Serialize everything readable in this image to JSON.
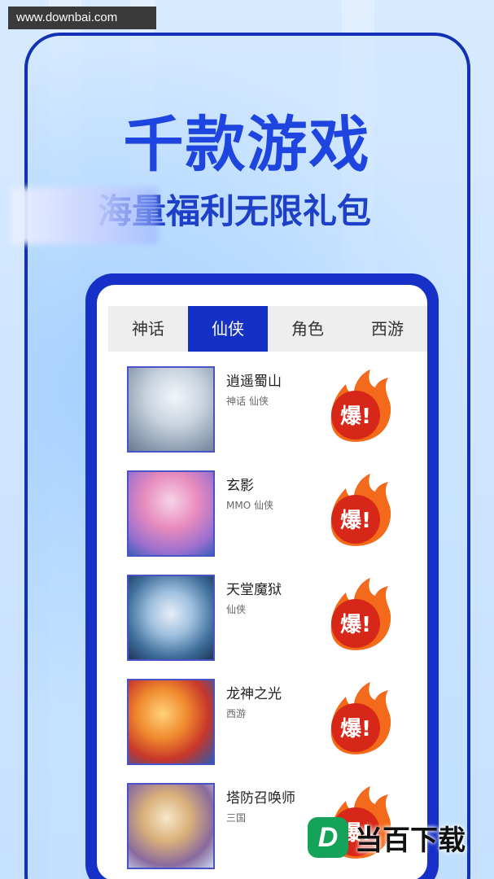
{
  "watermark": {
    "url": "www.downbai.com"
  },
  "hero": {
    "title": "千款游戏",
    "subtitle": "海量福利无限礼包"
  },
  "tabs": [
    {
      "label": "神话",
      "active": false
    },
    {
      "label": "仙侠",
      "active": true
    },
    {
      "label": "角色",
      "active": false
    },
    {
      "label": "西游",
      "active": false
    }
  ],
  "games": [
    {
      "name": "逍遥蜀山",
      "tags": "神话 仙侠",
      "badge": "爆!"
    },
    {
      "name": "玄影",
      "tags": "MMO 仙侠",
      "badge": "爆!"
    },
    {
      "name": "天堂魔狱",
      "tags": "仙侠",
      "badge": "爆!"
    },
    {
      "name": "龙神之光",
      "tags": "西游",
      "badge": "爆!"
    },
    {
      "name": "塔防召唤师",
      "tags": "三国",
      "badge": "爆!"
    }
  ],
  "brand": {
    "letter": "D",
    "name": "当百下载"
  },
  "colors": {
    "accent": "#1530c4",
    "title_blue": "#1e45df",
    "fire_orange": "#f36a1b",
    "fire_red": "#d62718",
    "brand_green": "#15a35a"
  }
}
